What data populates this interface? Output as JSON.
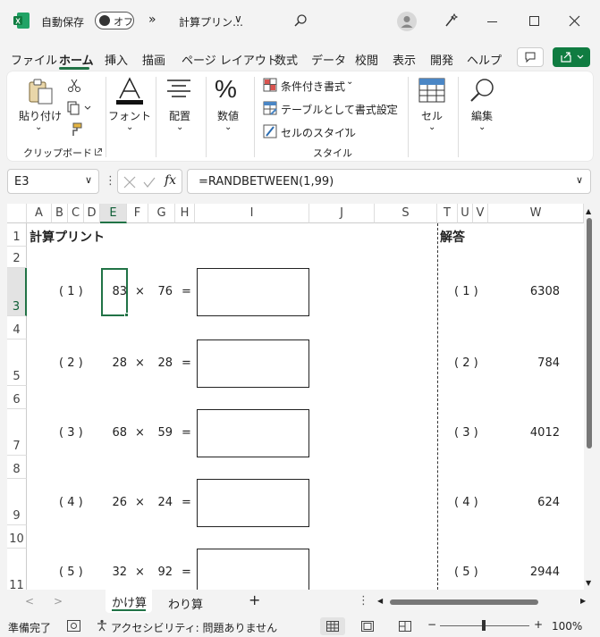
{
  "titlebar": {
    "autosave_label": "自動保存",
    "autosave_state": "オフ",
    "more": "»",
    "doc_title": "計算プリン…",
    "dropdown": "∨"
  },
  "tabs": [
    "ファイル",
    "ホーム",
    "挿入",
    "描画",
    "ページ レイアウト",
    "数式",
    "データ",
    "校閲",
    "表示",
    "開発",
    "ヘルプ"
  ],
  "ribbon": {
    "paste": "貼り付け",
    "clipboard_group": "クリップボード",
    "font": "フォント",
    "alignment": "配置",
    "number": "数値",
    "conditional": "条件付き書式",
    "format_table": "テーブルとして書式設定",
    "cell_style": "セルのスタイル",
    "style_group": "スタイル",
    "cells": "セル",
    "editing": "編集",
    "caret": "⌄"
  },
  "formula_bar": {
    "name_box": "E3",
    "fx": "fx",
    "formula": "=RANDBETWEEN(1,99)"
  },
  "columns": [
    "A",
    "B",
    "C",
    "D",
    "E",
    "F",
    "G",
    "H",
    "I",
    "J",
    "S",
    "T",
    "U",
    "V",
    "W"
  ],
  "rows": [
    "1",
    "2",
    "3",
    "4",
    "5",
    "6",
    "7",
    "8",
    "9",
    "10",
    "11"
  ],
  "sheet": {
    "title": "計算プリント",
    "answer_title": "解答",
    "times": "×",
    "equals": "=",
    "problems": [
      {
        "label": "( 1 )",
        "a": "83",
        "b": "76",
        "answer": "6308"
      },
      {
        "label": "( 2 )",
        "a": "28",
        "b": "28",
        "answer": "784"
      },
      {
        "label": "( 3 )",
        "a": "68",
        "b": "59",
        "answer": "4012"
      },
      {
        "label": "( 4 )",
        "a": "26",
        "b": "24",
        "answer": "624"
      },
      {
        "label": "( 5 )",
        "a": "32",
        "b": "92",
        "answer": "2944"
      }
    ]
  },
  "sheet_tabs": [
    "かけ算",
    "わり算"
  ],
  "add_sheet": "+",
  "status": {
    "ready": "準備完了",
    "accessibility": "アクセシビリティ: 問題ありません",
    "zoom_minus": "−",
    "zoom_plus": "+",
    "zoom": "100%"
  },
  "colors": {
    "accent": "#217346",
    "excel_green": "#107c41"
  }
}
